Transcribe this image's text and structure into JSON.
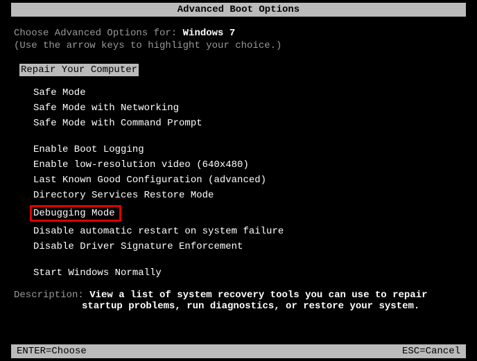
{
  "title": "Advanced Boot Options",
  "instruction_prefix": "Choose Advanced Options for: ",
  "os_name": "Windows 7",
  "instruction_sub": "(Use the arrow keys to highlight your choice.)",
  "selected_top": "Repair Your Computer",
  "options": {
    "group1": [
      "Safe Mode",
      "Safe Mode with Networking",
      "Safe Mode with Command Prompt"
    ],
    "group2": [
      "Enable Boot Logging",
      "Enable low-resolution video (640x480)",
      "Last Known Good Configuration (advanced)",
      "Directory Services Restore Mode",
      "Debugging Mode",
      "Disable automatic restart on system failure",
      "Disable Driver Signature Enforcement"
    ],
    "group3": [
      "Start Windows Normally"
    ]
  },
  "description_label": "Description: ",
  "description_line1": "View a list of system recovery tools you can use to repair",
  "description_line2": "startup problems, run diagnostics, or restore your system.",
  "footer": {
    "enter": "ENTER=Choose",
    "esc": "ESC=Cancel"
  }
}
